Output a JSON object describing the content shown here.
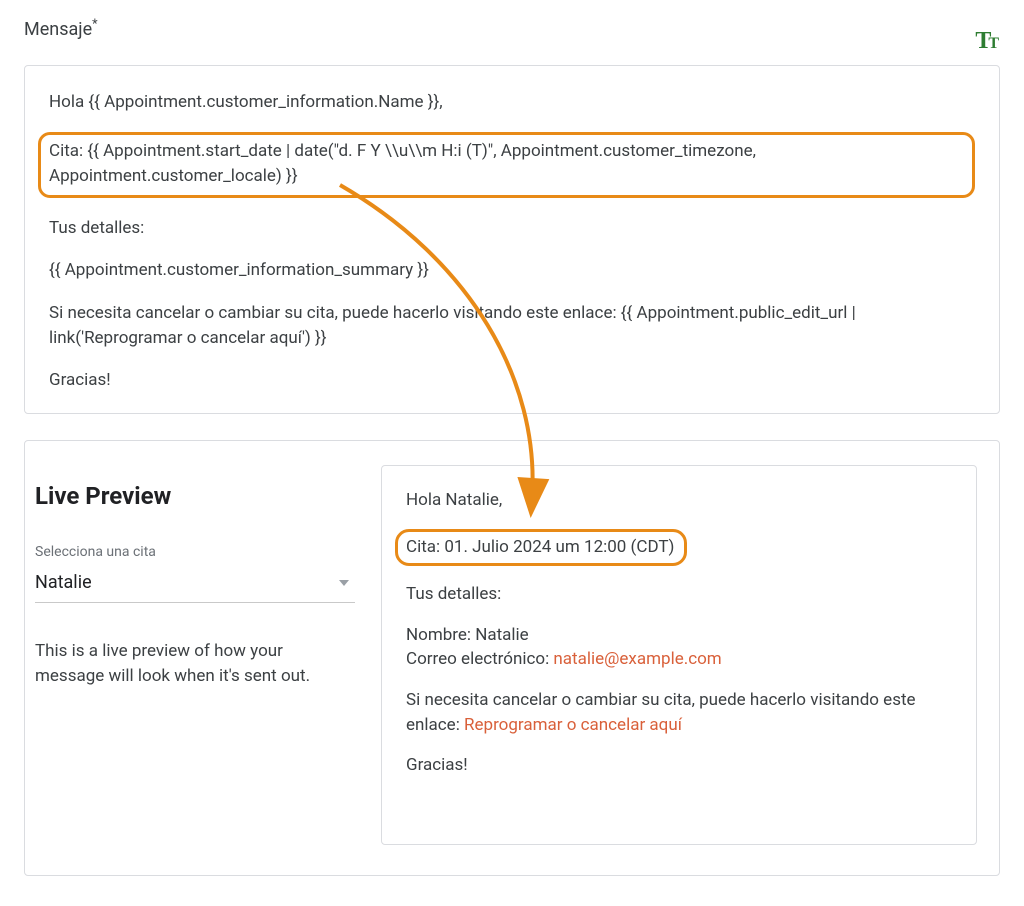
{
  "field": {
    "label": "Mensaje",
    "required_mark": "*"
  },
  "editor": {
    "greeting": "Hola {{ Appointment.customer_information.Name }},",
    "cita_line": "Cita: {{ Appointment.start_date | date(\"d. F Y \\\\u\\\\m H:i (T)\", Appointment.customer_timezone, Appointment.customer_locale) }}",
    "details_header": "Tus detalles:",
    "details_body": "{{ Appointment.customer_information_summary }}",
    "cancel_line": "Si necesita cancelar o cambiar su cita, puede hacerlo visitando este enlace: {{ Appointment.public_edit_url | link('Reprogramar o cancelar aquí') }}",
    "thanks": "Gracias!"
  },
  "preview_panel": {
    "title": "Live Preview",
    "select_label": "Selecciona una cita",
    "selected_option": "Natalie",
    "description": "This is a live preview of how your message will look when it's sent out."
  },
  "preview_output": {
    "greeting": "Hola Natalie,",
    "cita_line": "Cita: 01. Julio 2024 um 12:00 (CDT)",
    "details_header": "Tus detalles:",
    "name_line_label": "Nombre: ",
    "name_value": "Natalie",
    "email_label": "Correo electrónico: ",
    "email_value": "natalie@example.com",
    "cancel_prefix": "Si necesita cancelar o cambiar su cita, puede hacerlo visitando este enlace: ",
    "cancel_link": "Reprogramar o cancelar aquí",
    "thanks": "Gracias!"
  },
  "annotation": {
    "arrow_color": "#e88a17"
  }
}
